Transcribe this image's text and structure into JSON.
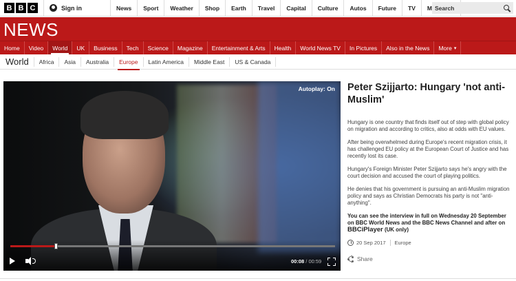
{
  "masthead": {
    "logo_letters": [
      "B",
      "B",
      "C"
    ],
    "signin_label": "Sign in",
    "nav": [
      "News",
      "Sport",
      "Weather",
      "Shop",
      "Earth",
      "Travel",
      "Capital",
      "Culture",
      "Autos",
      "Future",
      "TV"
    ],
    "more_label": "More",
    "more_arrow": "▾",
    "search_placeholder": "Search"
  },
  "banner": {
    "wordmark": "NEWS",
    "color": "#bb1919"
  },
  "section_nav": {
    "items": [
      "Home",
      "Video",
      "World",
      "UK",
      "Business",
      "Tech",
      "Science",
      "Magazine",
      "Entertainment & Arts",
      "Health",
      "World News TV",
      "In Pictures",
      "Also in the News"
    ],
    "active": "World",
    "more_label": "More",
    "more_arrow": "▾"
  },
  "sub_nav": {
    "title": "World",
    "items": [
      "Africa",
      "Asia",
      "Australia",
      "Europe",
      "Latin America",
      "Middle East",
      "US & Canada"
    ],
    "active": "Europe"
  },
  "player": {
    "autoplay_label": "Autoplay: On",
    "current_time": "00:08",
    "separator": " / ",
    "duration": "00:59",
    "progress_fraction": 0.14
  },
  "article": {
    "headline": "Peter Szijjarto: Hungary 'not anti-Muslim'",
    "paragraphs": [
      "Hungary is one country that finds itself out of step with global policy on migration and according to critics, also at odds with EU values.",
      "After being overwhelmed during Europe's recent migration crisis, it has challenged EU policy at the European Court of Justice and has recently lost its case.",
      "Hungary's Foreign Minister Peter Szijjarto says he's angry with the court decision and accused the court of playing politics.",
      "He denies that his government is pursuing an anti-Muslim migration policy and says as Christian Democrats his party is not \"anti-anything\"."
    ],
    "promo_prefix": "You can see the interview in full on Wednesday 20 September on BBC World News and the BBC News Channel and after on ",
    "promo_iplayer": "BBCiPlayer",
    "promo_suffix": " (UK only)",
    "date": "20 Sep 2017",
    "tag": "Europe",
    "share_label": "Share"
  }
}
